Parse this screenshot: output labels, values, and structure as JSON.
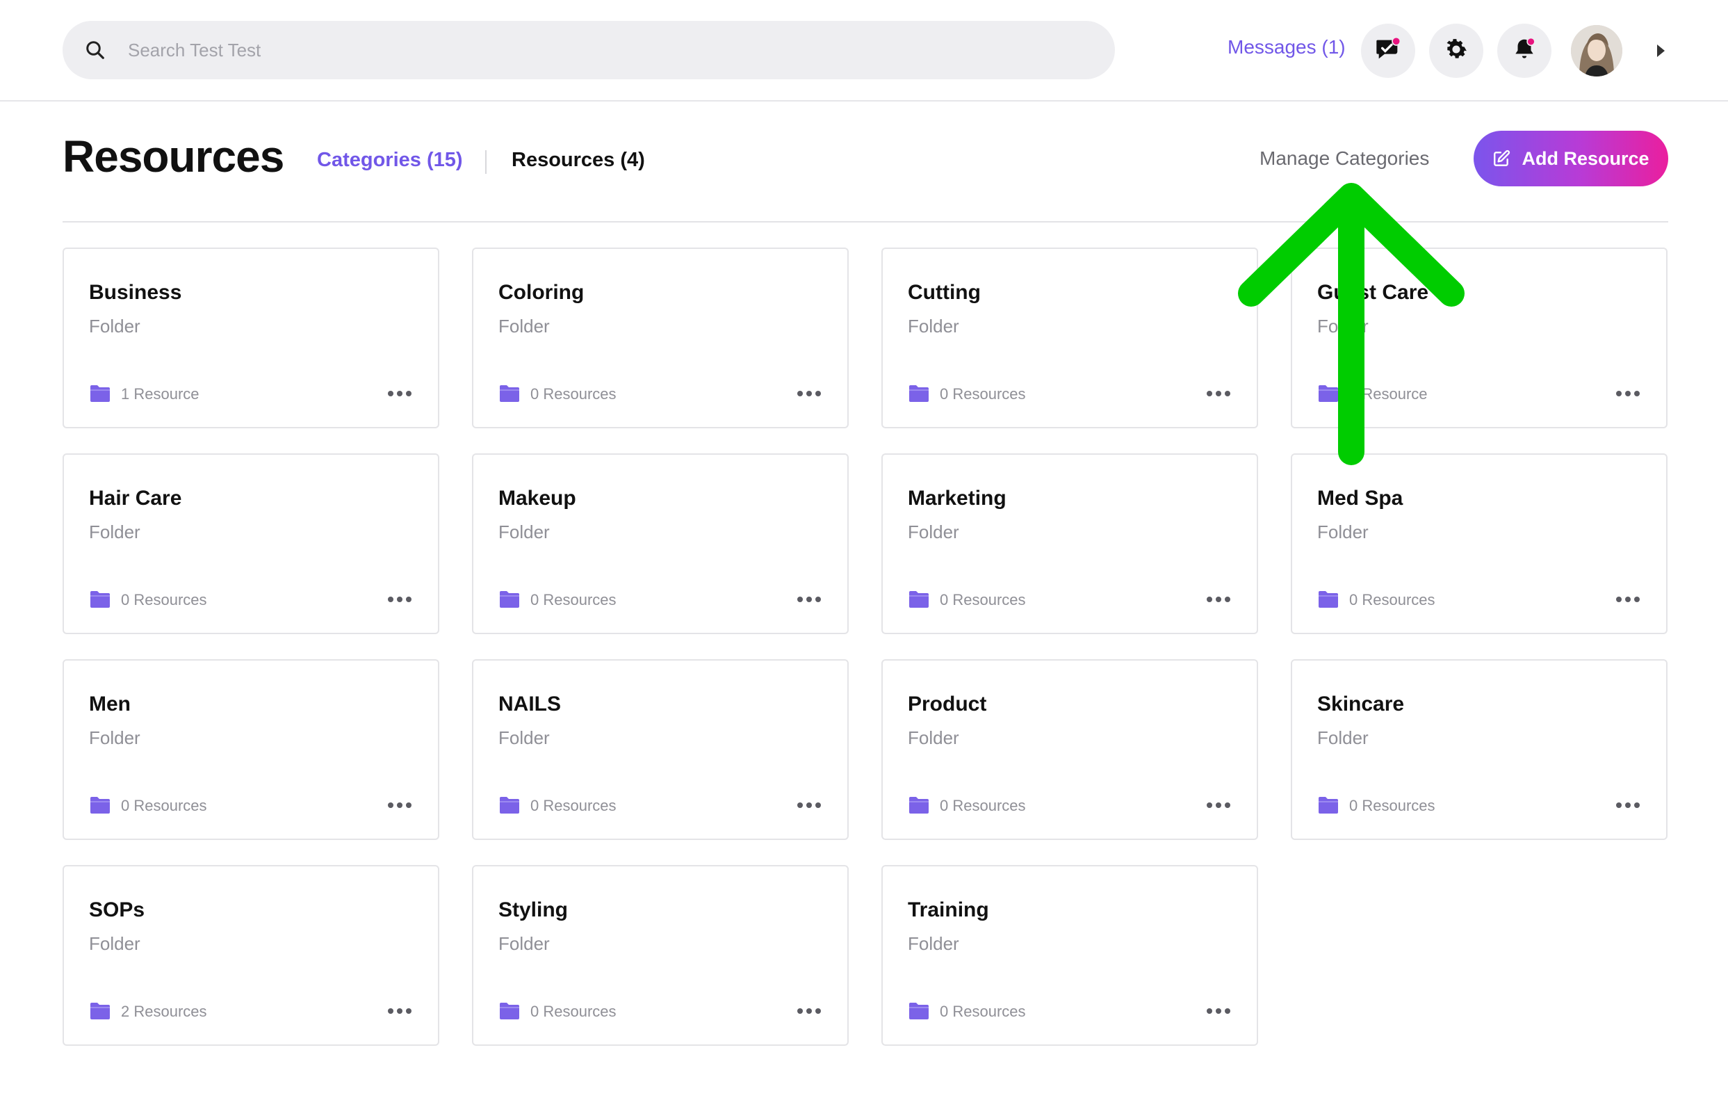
{
  "search": {
    "placeholder": "Search Test Test"
  },
  "header": {
    "messages_label": "Messages (1)",
    "icons": [
      "chat-alert-icon",
      "gear-icon",
      "bell-icon",
      "avatar",
      "caret-right-icon"
    ],
    "accent_color": "#7157e8",
    "notification_color": "#e8147f"
  },
  "page": {
    "title": "Resources",
    "tabs": [
      {
        "label": "Categories (15)",
        "active": true
      },
      {
        "label": "Resources (4)",
        "active": false
      }
    ],
    "manage_label": "Manage Categories",
    "add_label": "Add Resource"
  },
  "cards": [
    {
      "name": "Business",
      "type": "Folder",
      "count": "1 Resource"
    },
    {
      "name": "Coloring",
      "type": "Folder",
      "count": "0 Resources"
    },
    {
      "name": "Cutting",
      "type": "Folder",
      "count": "0 Resources"
    },
    {
      "name": "Guest Care",
      "type": "Folder",
      "count": "1 Resource"
    },
    {
      "name": "Hair Care",
      "type": "Folder",
      "count": "0 Resources"
    },
    {
      "name": "Makeup",
      "type": "Folder",
      "count": "0 Resources"
    },
    {
      "name": "Marketing",
      "type": "Folder",
      "count": "0 Resources"
    },
    {
      "name": "Med Spa",
      "type": "Folder",
      "count": "0 Resources"
    },
    {
      "name": "Men",
      "type": "Folder",
      "count": "0 Resources"
    },
    {
      "name": "NAILS",
      "type": "Folder",
      "count": "0 Resources"
    },
    {
      "name": "Product",
      "type": "Folder",
      "count": "0 Resources"
    },
    {
      "name": "Skincare",
      "type": "Folder",
      "count": "0 Resources"
    },
    {
      "name": "SOPs",
      "type": "Folder",
      "count": "2 Resources"
    },
    {
      "name": "Styling",
      "type": "Folder",
      "count": "0 Resources"
    },
    {
      "name": "Training",
      "type": "Folder",
      "count": "0 Resources"
    }
  ],
  "annotation": {
    "arrow_color": "#00cc00",
    "icon": "arrow-up-icon"
  }
}
